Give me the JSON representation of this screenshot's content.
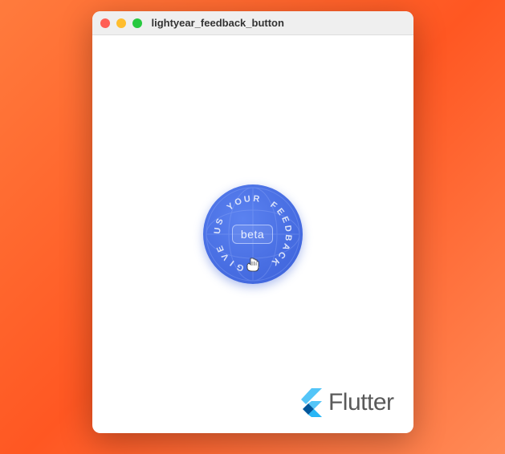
{
  "window": {
    "title": "lightyear_feedback_button"
  },
  "feedback": {
    "circular_text": "GIVE US YOUR FEEDBACK . ",
    "badge_label": "beta"
  },
  "branding": {
    "name": "Flutter"
  },
  "colors": {
    "button_bg": "#3a5fd8",
    "accent": "#4a6ee0"
  }
}
